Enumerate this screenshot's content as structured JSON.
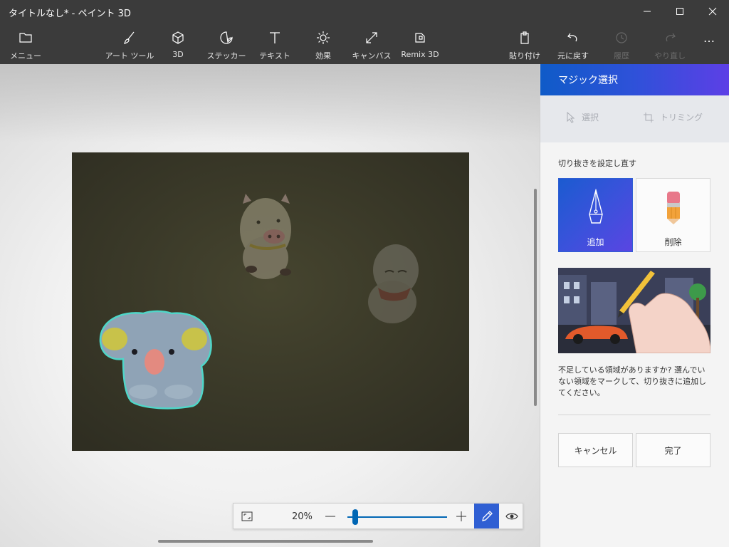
{
  "window": {
    "title": "タイトルなし* - ペイント 3D"
  },
  "toolbar": {
    "items": [
      {
        "label": "メニュー",
        "icon": "folder-icon"
      },
      {
        "label": "アート ツール",
        "icon": "brush-icon"
      },
      {
        "label": "3D",
        "icon": "cube-icon"
      },
      {
        "label": "ステッカー",
        "icon": "sticker-icon"
      },
      {
        "label": "テキスト",
        "icon": "text-icon"
      },
      {
        "label": "効果",
        "icon": "sun-icon"
      },
      {
        "label": "キャンバス",
        "icon": "canvas-resize-icon"
      },
      {
        "label": "Remix 3D",
        "icon": "remix-icon"
      }
    ],
    "right_items": [
      {
        "label": "貼り付け",
        "icon": "paste-icon",
        "enabled": true
      },
      {
        "label": "元に戻す",
        "icon": "undo-icon",
        "enabled": true
      },
      {
        "label": "履歴",
        "icon": "history-icon",
        "enabled": false
      },
      {
        "label": "やり直し",
        "icon": "redo-icon",
        "enabled": false
      }
    ],
    "more": "…"
  },
  "zoom": {
    "value": "20%",
    "level": 0.08,
    "minus": "—",
    "plus": "+"
  },
  "panel": {
    "title": "マジック選択",
    "modes": {
      "select": "選択",
      "trim": "トリミング"
    },
    "reset_label": "切り抜きを設定し直す",
    "add_label": "追加",
    "remove_label": "削除",
    "description": "不足している領域がありますか? 選んでいない領域をマークして、切り抜きに追加してください。",
    "cancel_label": "キャンセル",
    "done_label": "完了"
  },
  "colors": {
    "accent": "#2f5fd3",
    "header_start": "#0f5bc8",
    "header_end": "#5d3fe6",
    "titlebar": "#3b3b3b",
    "selection_outline": "#39c4b8"
  }
}
